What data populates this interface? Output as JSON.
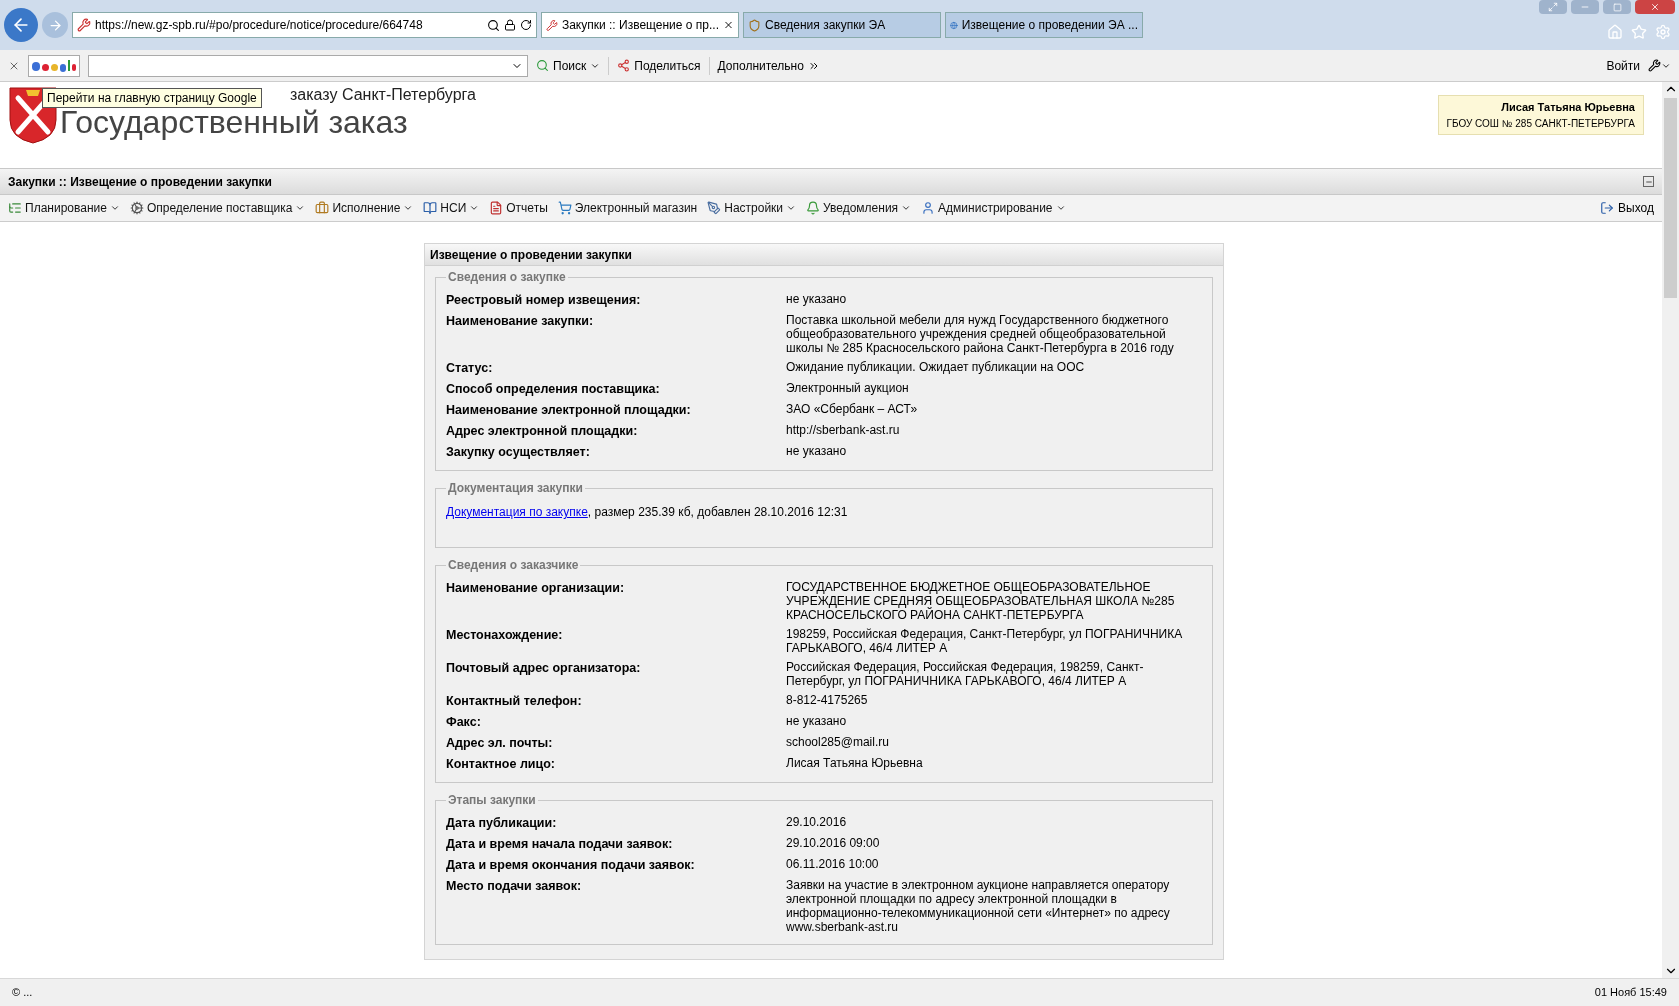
{
  "browser": {
    "address": "https://new.gz-spb.ru/#po/procedure/notice/procedure/664748",
    "tabs": [
      {
        "label": "Закупки :: Извещение о пр...",
        "selected": true
      },
      {
        "label": "Сведения закупки ЭА",
        "selected": false
      },
      {
        "label": "Извещение о проведении ЭА ...",
        "selected": false
      }
    ]
  },
  "google_toolbar": {
    "search_button": "Поиск",
    "share_button": "Поделиться",
    "more_button": "Дополнительно",
    "sign_in": "Войти"
  },
  "header": {
    "tooltip": "Перейти на главную страницу Google",
    "subtitle": "заказу Санкт-Петербурга",
    "title": "Государственный заказ",
    "user_name": "Лисая Татьяна Юрьевна",
    "user_org": "ГБОУ СОШ № 285 САНКТ-ПЕТЕРБУРГА"
  },
  "page_title": "Закупки :: Извещение о проведении закупки",
  "menu": [
    {
      "label": "Планирование",
      "dropdown": true
    },
    {
      "label": "Определение поставщика",
      "dropdown": true
    },
    {
      "label": "Исполнение",
      "dropdown": true
    },
    {
      "label": "НСИ",
      "dropdown": true
    },
    {
      "label": "Отчеты",
      "dropdown": false
    },
    {
      "label": "Электронный магазин",
      "dropdown": false
    },
    {
      "label": "Настройки",
      "dropdown": true
    },
    {
      "label": "Уведомления",
      "dropdown": true
    },
    {
      "label": "Администрирование",
      "dropdown": true
    }
  ],
  "logout": "Выход",
  "panel": {
    "title": "Извещение о проведении закупки",
    "sections": [
      {
        "kind": "fields",
        "title": "Сведения о закупке",
        "rows": [
          {
            "label": "Реестровый номер извещения:",
            "value": "не указано"
          },
          {
            "label": "Наименование закупки:",
            "value": "Поставка школьной мебели для нужд Государственного бюджетного общеобразовательного учреждения средней общеобразовательной школы № 285 Красносельского района Санкт-Петербурга в 2016 году"
          },
          {
            "label": "Статус:",
            "value": "Ожидание публикации. Ожидает публикации на ООС"
          },
          {
            "label": "Способ определения поставщика:",
            "value": "Электронный аукцион"
          },
          {
            "label": "Наименование электронной площадки:",
            "value": "ЗАО «Сбербанк – АСТ»"
          },
          {
            "label": "Адрес электронной площадки:",
            "value": "http://sberbank-ast.ru"
          },
          {
            "label": "Закупку осуществляет:",
            "value": "не указано"
          }
        ]
      },
      {
        "kind": "document",
        "title": "Документация закупки",
        "link": "Документация по закупке",
        "text": ", размер 235.39 кб, добавлен 28.10.2016 12:31"
      },
      {
        "kind": "fields",
        "title": "Сведения о заказчике",
        "rows": [
          {
            "label": "Наименование организации:",
            "value": "ГОСУДАРСТВЕННОЕ БЮДЖЕТНОЕ ОБЩЕОБРАЗОВАТЕЛЬНОЕ УЧРЕЖДЕНИЕ СРЕДНЯЯ ОБЩЕОБРАЗОВАТЕЛЬНАЯ ШКОЛА №285 КРАСНОСЕЛЬСКОГО РАЙОНА САНКТ-ПЕТЕРБУРГА"
          },
          {
            "label": "Местонахождение:",
            "value": "198259, Российская Федерация, Санкт-Петербург, ул ПОГРАНИЧНИКА ГАРЬКАВОГО, 46/4 ЛИТЕР А"
          },
          {
            "label": "Почтовый адрес организатора:",
            "value": "Российская Федерация, Российская Федерация, 198259, Санкт-Петербург, ул ПОГРАНИЧНИКА ГАРЬКАВОГО, 46/4 ЛИТЕР А"
          },
          {
            "label": "Контактный телефон:",
            "value": "8-812-4175265"
          },
          {
            "label": "Факс:",
            "value": "не указано"
          },
          {
            "label": "Адрес эл. почты:",
            "value": "school285@mail.ru"
          },
          {
            "label": "Контактное лицо:",
            "value": "Лисая Татьяна Юрьевна"
          }
        ]
      },
      {
        "kind": "fields",
        "title": "Этапы закупки",
        "rows": [
          {
            "label": "Дата публикации:",
            "value": "29.10.2016"
          },
          {
            "label": "Дата и время начала подачи заявок:",
            "value": "29.10.2016 09:00"
          },
          {
            "label": "Дата и время окончания подачи заявок:",
            "value": "06.11.2016 10:00"
          },
          {
            "label": "Место подачи заявок:",
            "value": "Заявки на участие в электронном аукционе направляется оператору электронной площадки по адресу электронной площадки в информационно-телекоммуникационной сети «Интернет» по адресу www.sberbank-ast.ru"
          }
        ]
      }
    ]
  },
  "status_bar": {
    "left": "© ...",
    "right": "01 Нояб 15:49"
  }
}
